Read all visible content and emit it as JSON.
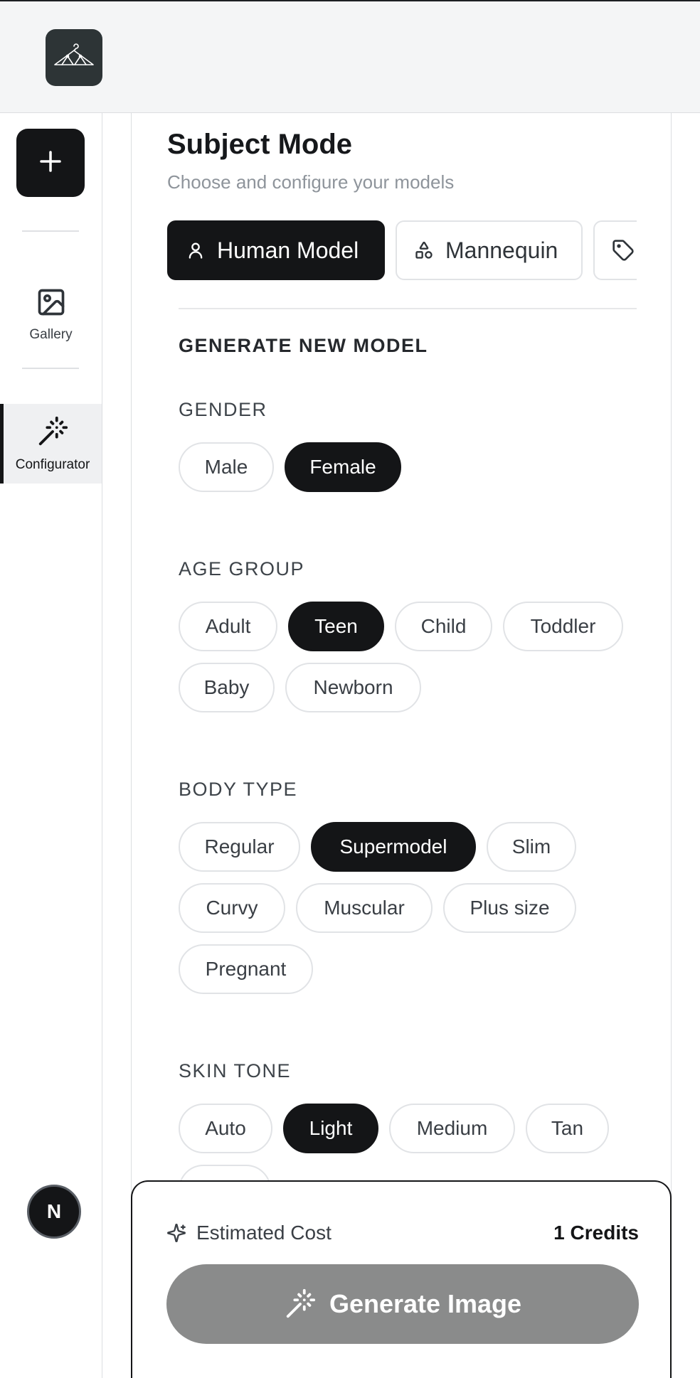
{
  "header": {
    "logo_icon": "hanger-logo-icon"
  },
  "sidebar": {
    "new_icon": "plus-icon",
    "items": [
      {
        "label": "Gallery",
        "icon": "image-icon",
        "active": false
      },
      {
        "label": "Configurator",
        "icon": "magic-wand-icon",
        "active": true
      }
    ],
    "avatar_letter": "N"
  },
  "main": {
    "title": "Subject Mode",
    "subtitle": "Choose and configure your models",
    "modes": [
      {
        "label": "Human Model",
        "icon": "user-icon",
        "active": true
      },
      {
        "label": "Mannequin",
        "icon": "shapes-icon",
        "active": false
      },
      {
        "label": "",
        "icon": "tag-icon",
        "active": false
      }
    ],
    "section_title": "GENERATE NEW MODEL",
    "gender": {
      "label": "GENDER",
      "options": [
        "Male",
        "Female"
      ],
      "selected": "Female"
    },
    "age_group": {
      "label": "AGE GROUP",
      "options": [
        "Adult",
        "Teen",
        "Child",
        "Toddler",
        "Baby",
        "Newborn"
      ],
      "selected": "Teen"
    },
    "body_type": {
      "label": "BODY TYPE",
      "options": [
        "Regular",
        "Supermodel",
        "Slim",
        "Curvy",
        "Muscular",
        "Plus size",
        "Pregnant"
      ],
      "selected": "Supermodel"
    },
    "skin_tone": {
      "label": "SKIN TONE",
      "options": [
        "Auto",
        "Light",
        "Medium",
        "Tan"
      ],
      "selected": "Light"
    }
  },
  "footer": {
    "cost_label": "Estimated Cost",
    "cost_value": "1 Credits",
    "generate_label": "Generate Image"
  },
  "colors": {
    "accent": "#141517",
    "disabled_button": "#8a8b8b",
    "muted_text": "#8e949b"
  }
}
